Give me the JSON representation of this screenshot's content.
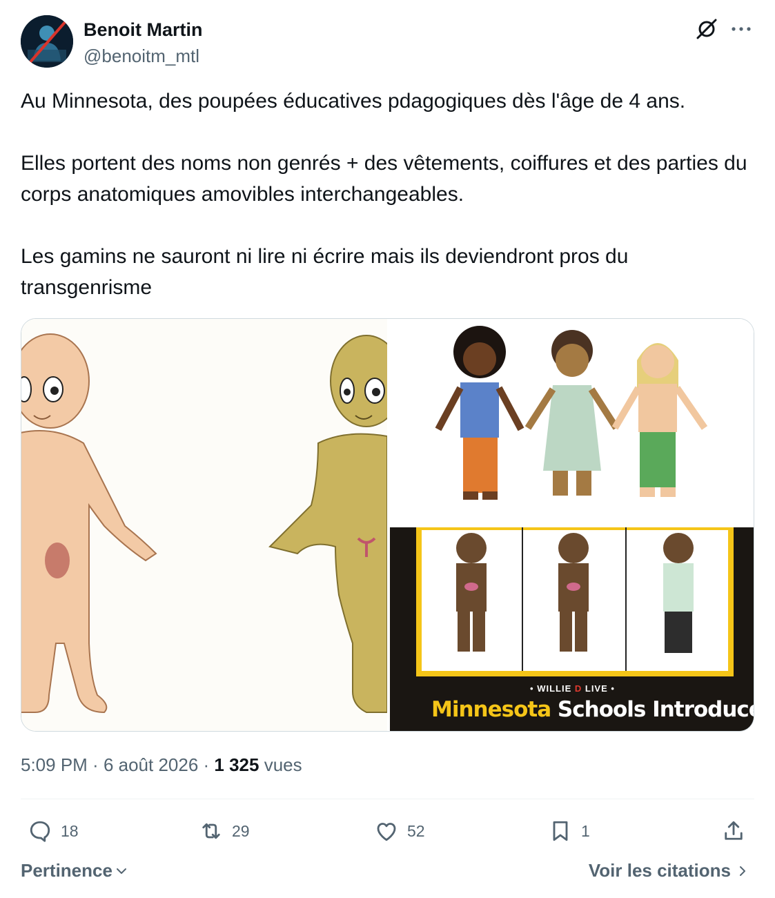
{
  "author": {
    "name": "Benoit Martin",
    "handle": "@benoitm_mtl"
  },
  "icons": {
    "grok": "grok-icon",
    "more": "more-options-icon",
    "reply": "reply-icon",
    "repost": "repost-icon",
    "like": "like-icon",
    "bookmark": "bookmark-icon",
    "share": "share-icon"
  },
  "tweet": {
    "paragraphs": [
      "Au Minnesota, des poupées éducatives pdagogiques dès l'âge de 4 ans.",
      "Elles portent des noms non genrés + des vêtements, coiffures et des parties du corps anatomiques amovibles interchangeables.",
      "Les gamins ne sauront ni lire ni écrire mais ils deviendront pros du transgenrisme"
    ]
  },
  "media": {
    "banner_brand_prefix": "• WILLIE ",
    "banner_brand_d": "D",
    "banner_brand_suffix": " LIVE •",
    "banner_title_highlight": "Minnesota",
    "banner_title_rest": " Schools Introduce"
  },
  "meta": {
    "time": "5:09 PM",
    "separator": " · ",
    "date": "6 août 2026",
    "views_count": "1 325",
    "views_label": " vues"
  },
  "stats": {
    "replies": "18",
    "reposts": "29",
    "likes": "52",
    "bookmarks": "1"
  },
  "footer": {
    "sort_label": "Pertinence",
    "quotes_label": "Voir les citations"
  },
  "colors": {
    "text_primary": "#0f1419",
    "text_secondary": "#536471",
    "border": "#cfd9de",
    "banner_highlight": "#f5c518"
  }
}
